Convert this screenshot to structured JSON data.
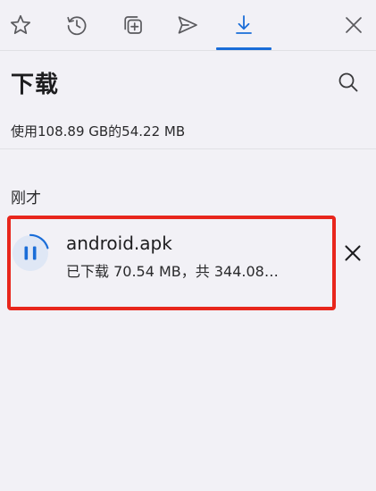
{
  "toolbar": {
    "icons": [
      "star-icon",
      "history-icon",
      "collections-icon",
      "share-icon",
      "download-icon",
      "close-icon"
    ],
    "active_tab": "downloads",
    "accent_color": "#1a6dd8"
  },
  "header": {
    "title": "下载",
    "search_icon": "search-icon"
  },
  "storage_text": "使用108.89 GB的54.22 MB",
  "section_label": "刚才",
  "download_item": {
    "file_name": "android.apk",
    "status": "已下载 70.54 MB，共 344.08…",
    "progress_fraction": 0.205,
    "state_icon": "pause-icon",
    "cancel_icon": "close-icon"
  },
  "highlight_color": "#e8261c"
}
